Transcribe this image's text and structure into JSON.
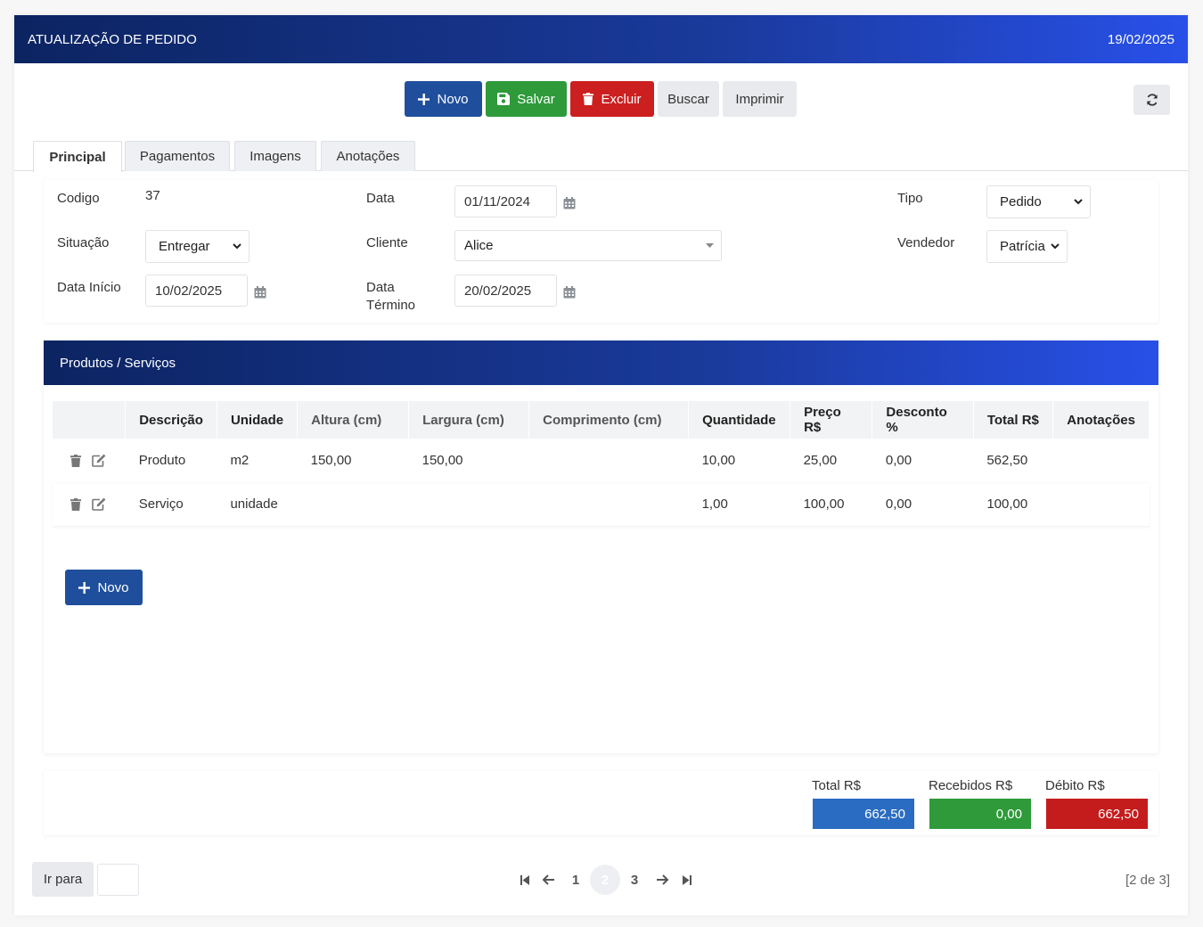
{
  "header": {
    "title": "ATUALIZAÇÃO DE PEDIDO",
    "date": "19/02/2025"
  },
  "toolbar": {
    "novo": "Novo",
    "salvar": "Salvar",
    "excluir": "Excluir",
    "buscar": "Buscar",
    "imprimir": "Imprimir"
  },
  "tabs": [
    {
      "label": "Principal",
      "active": true
    },
    {
      "label": "Pagamentos"
    },
    {
      "label": "Imagens"
    },
    {
      "label": "Anotações"
    }
  ],
  "form": {
    "codigo_label": "Codigo",
    "codigo": "37",
    "data_label": "Data",
    "data": "01/11/2024",
    "tipo_label": "Tipo",
    "tipo": "Pedido",
    "situacao_label": "Situação",
    "situacao": "Entregar",
    "cliente_label": "Cliente",
    "cliente": "Alice",
    "vendedor_label": "Vendedor",
    "vendedor": "Patrícia",
    "data_inicio_label": "Data Início",
    "data_inicio": "10/02/2025",
    "data_termino_label_1": "Data",
    "data_termino_label_2": "Término",
    "data_termino": "20/02/2025"
  },
  "products": {
    "title": "Produtos / Serviços",
    "columns": [
      "Descrição",
      "Unidade",
      "Altura (cm)",
      "Largura (cm)",
      "Comprimento (cm)",
      "Quantidade",
      "Preço R$",
      "Desconto %",
      "Total R$",
      "Anotações"
    ],
    "rows": [
      [
        "Produto",
        "m2",
        "150,00",
        "150,00",
        "",
        "10,00",
        "25,00",
        "0,00",
        "562,50",
        ""
      ],
      [
        "Serviço",
        "unidade",
        "",
        "",
        "",
        "1,00",
        "100,00",
        "0,00",
        "100,00",
        ""
      ]
    ],
    "novo_label": "Novo"
  },
  "totals": {
    "total_label": "Total R$",
    "total": "662,50",
    "recebidos_label": "Recebidos R$",
    "recebidos": "0,00",
    "debito_label": "Débito R$",
    "debito": "662,50"
  },
  "footer": {
    "goto_label": "Ir para",
    "pages": [
      "1",
      "2",
      "3"
    ],
    "current_page": "2",
    "page_info": "[2 de 3]"
  },
  "colors": {
    "header_start": "#0c2461",
    "header_end": "#2850e8",
    "primary": "#1f4f9c",
    "success": "#2e9a3a",
    "danger": "#cc1f1f",
    "total_box": "#2a6cc1",
    "received_box": "#2e9a3a",
    "debit_box": "#c41c1c"
  }
}
